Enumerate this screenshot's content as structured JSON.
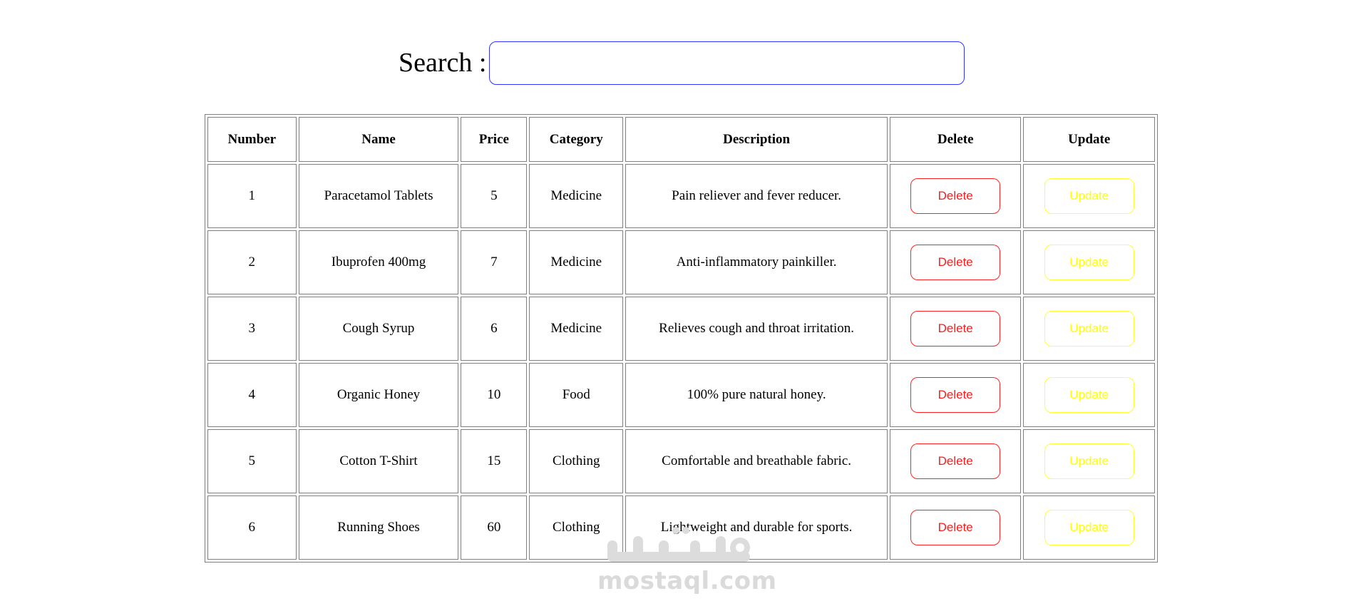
{
  "search": {
    "label": "Search :",
    "value": "",
    "placeholder": "",
    "border_color": "#3333ff"
  },
  "table": {
    "headers": {
      "number": "Number",
      "name": "Name",
      "price": "Price",
      "category": "Category",
      "description": "Description",
      "delete": "Delete",
      "update": "Update"
    },
    "rows": [
      {
        "number": "1",
        "name": "Paracetamol Tablets",
        "price": "5",
        "category": "Medicine",
        "description": "Pain reliever and fever reducer.",
        "delete_label": "Delete",
        "update_label": "Update"
      },
      {
        "number": "2",
        "name": "Ibuprofen 400mg",
        "price": "7",
        "category": "Medicine",
        "description": "Anti-inflammatory painkiller.",
        "delete_label": "Delete",
        "update_label": "Update"
      },
      {
        "number": "3",
        "name": "Cough Syrup",
        "price": "6",
        "category": "Medicine",
        "description": "Relieves cough and throat irritation.",
        "delete_label": "Delete",
        "update_label": "Update"
      },
      {
        "number": "4",
        "name": "Organic Honey",
        "price": "10",
        "category": "Food",
        "description": "100% pure natural honey.",
        "delete_label": "Delete",
        "update_label": "Update"
      },
      {
        "number": "5",
        "name": "Cotton T-Shirt",
        "price": "15",
        "category": "Clothing",
        "description": "Comfortable and breathable fabric.",
        "delete_label": "Delete",
        "update_label": "Update"
      },
      {
        "number": "6",
        "name": "Running Shoes",
        "price": "60",
        "category": "Clothing",
        "description": "Lightweight and durable for sports.",
        "delete_label": "Delete",
        "update_label": "Update"
      }
    ]
  },
  "colors": {
    "delete": "#ff1a1a",
    "update": "#ffff00",
    "border": "#808080"
  },
  "watermark": {
    "text": "mostaql.com",
    "logo_icon": "mostaql-logo-icon"
  }
}
